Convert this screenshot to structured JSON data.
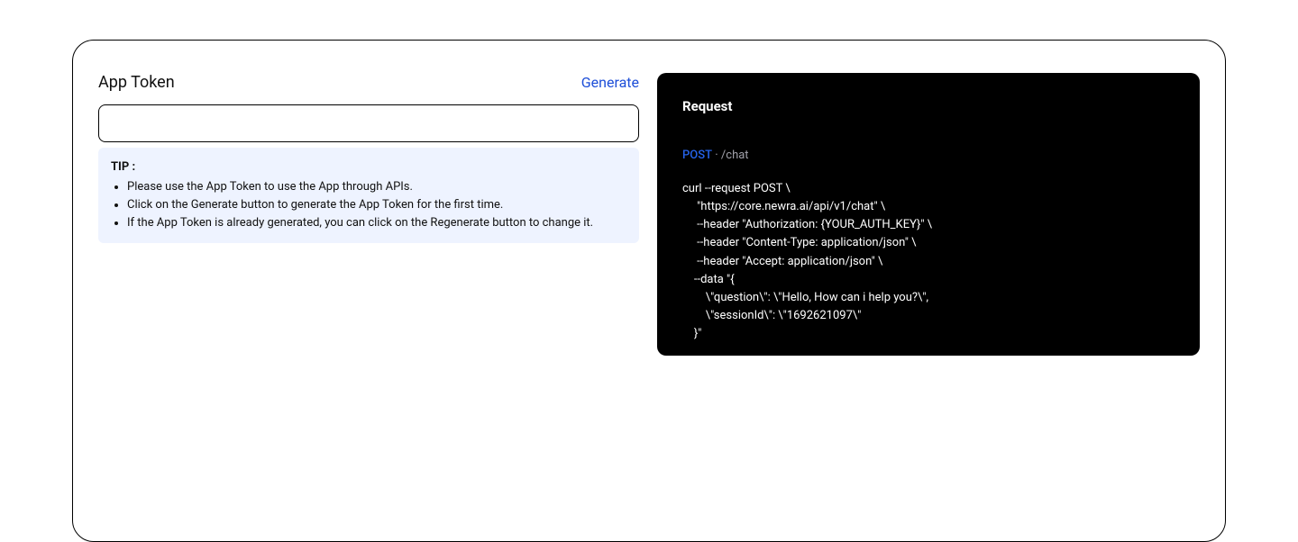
{
  "left": {
    "title": "App Token",
    "generate_label": "Generate",
    "token_value": "",
    "tip_label": "TIP :",
    "tips": [
      "Please use the App Token to use the App through APIs.",
      "Click on the Generate button to generate the App Token for the first time.",
      "If the App Token is already generated, you can click on the Regenerate button to change it."
    ]
  },
  "right": {
    "request_label": "Request",
    "method": "POST",
    "separator": "·",
    "path": "/chat",
    "code": "curl --request POST \\\n     \"https://core.newra.ai/api/v1/chat\" \\\n     --header \"Authorization: {YOUR_AUTH_KEY}\" \\\n     --header \"Content-Type: application/json\" \\\n     --header \"Accept: application/json\" \\\n    --data \"{\n        \\\"question\\\": \\\"Hello, How can i help you?\\\",\n        \\\"sessionId\\\": \\\"1692621097\\\"\n    }\""
  }
}
